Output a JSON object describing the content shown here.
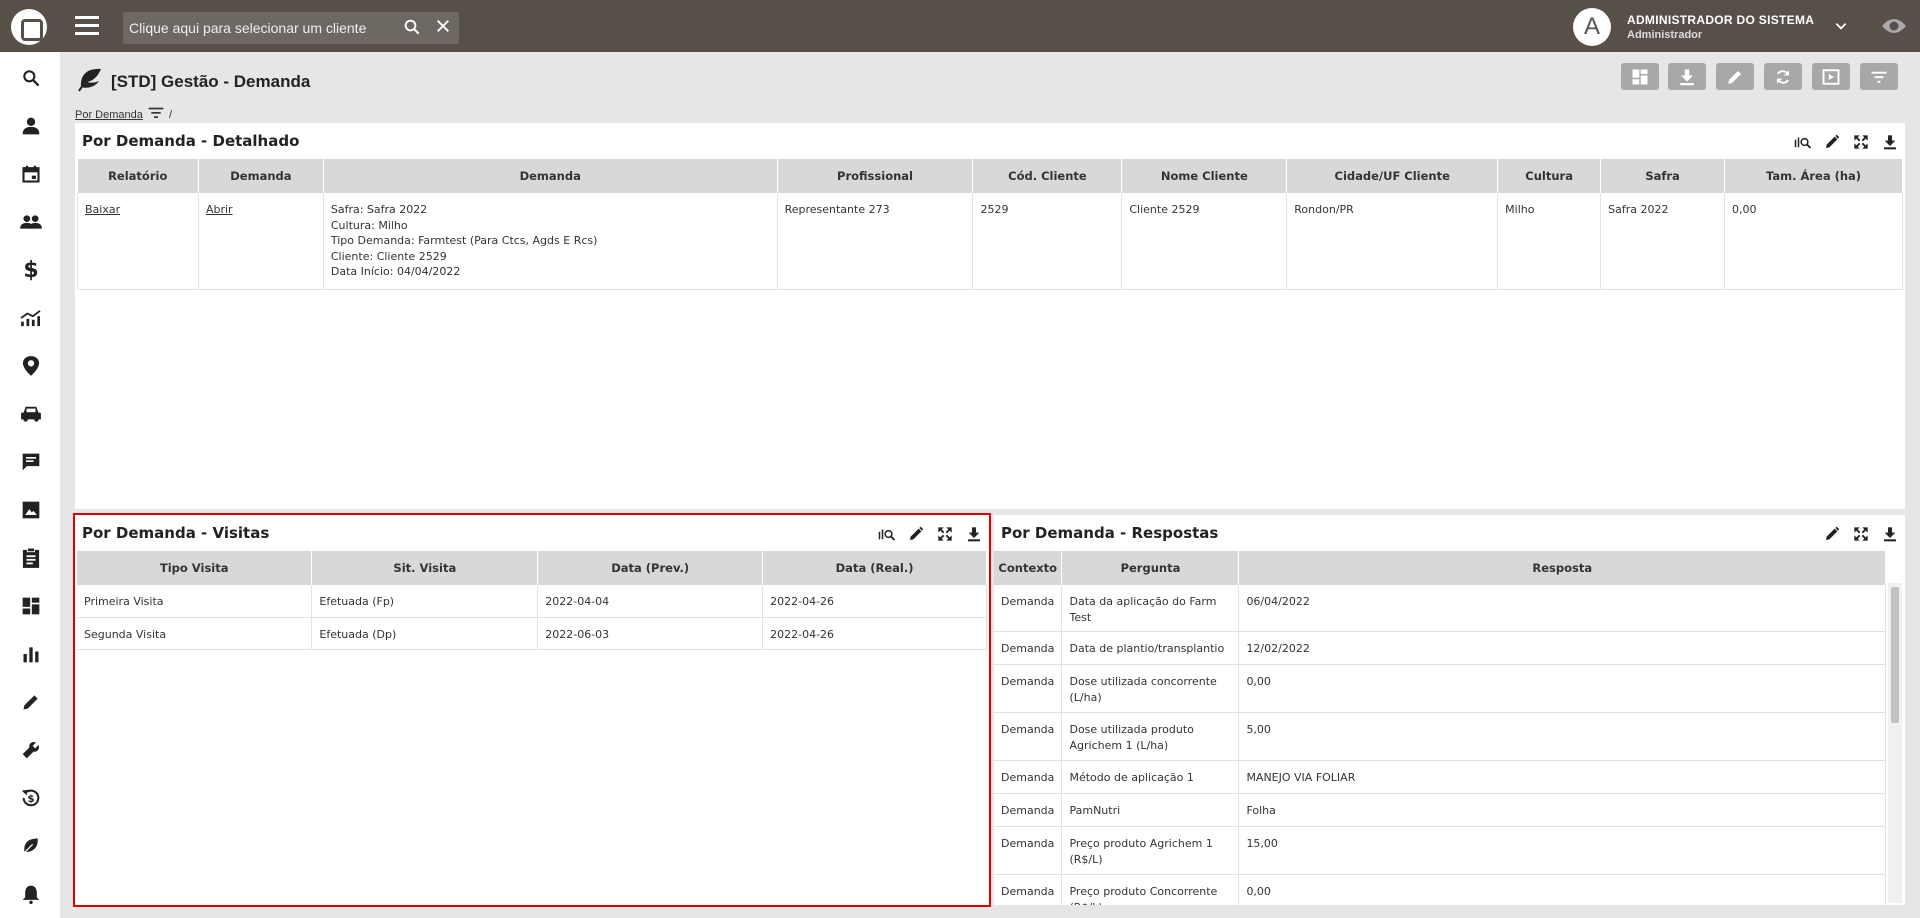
{
  "topbar": {
    "search_placeholder": "Clique aqui para selecionar um cliente",
    "avatar_letter": "A",
    "user_name": "ADMINISTRADOR DO SISTEMA",
    "user_role": "Administrador"
  },
  "sidebar": {
    "items": [
      "search",
      "person",
      "calendar",
      "people",
      "dollar",
      "chart-trend",
      "location-pin",
      "car",
      "chat",
      "image",
      "clipboard",
      "dashboard",
      "bar-chart",
      "pencil",
      "wrench",
      "money-history",
      "leaf",
      "alert"
    ]
  },
  "page": {
    "title": "[STD] Gestão - Demanda",
    "breadcrumb_link": "Por Demanda",
    "breadcrumb_sep": "/"
  },
  "panel_detail": {
    "title": "Por Demanda - Detalhado",
    "headers": [
      "Relatório",
      "Demanda",
      "Demanda",
      "Profissional",
      "Cód. Cliente",
      "Nome Cliente",
      "Cidade/UF Cliente",
      "Cultura",
      "Safra",
      "Tam. Área (ha)"
    ],
    "row": {
      "relatorio": "Baixar",
      "demanda_link": "Abrir",
      "demanda_lines": [
        "Safra: Safra 2022",
        "Cultura: Milho",
        "Tipo Demanda: Farmtest (Para Ctcs, Agds E Rcs)",
        "Cliente: Cliente 2529",
        "Data Início: 04/04/2022"
      ],
      "profissional": "Representante 273",
      "cod_cliente": "2529",
      "nome_cliente": "Cliente 2529",
      "cidade": "Rondon/PR",
      "cultura": "Milho",
      "safra": "Safra 2022",
      "area": "0,00"
    }
  },
  "panel_visits": {
    "title": "Por Demanda - Visitas",
    "headers": [
      "Tipo Visita",
      "Sit. Visita",
      "Data (Prev.)",
      "Data (Real.)"
    ],
    "rows": [
      [
        "Primeira Visita",
        "Efetuada (Fp)",
        "2022-04-04",
        "2022-04-26"
      ],
      [
        "Segunda Visita",
        "Efetuada (Dp)",
        "2022-06-03",
        "2022-04-26"
      ]
    ]
  },
  "panel_answers": {
    "title": "Por Demanda - Respostas",
    "headers": [
      "Contexto",
      "Pergunta",
      "Resposta"
    ],
    "rows": [
      [
        "Demanda",
        "Data da aplicação do Farm Test",
        "06/04/2022"
      ],
      [
        "Demanda",
        "Data de plantio/transplantio",
        "12/02/2022"
      ],
      [
        "Demanda",
        "Dose utilizada concorrente (L/ha)",
        "0,00"
      ],
      [
        "Demanda",
        "Dose utilizada produto Agrichem 1 (L/ha)",
        "5,00"
      ],
      [
        "Demanda",
        "Método de aplicação 1",
        "MANEJO VIA FOLIAR"
      ],
      [
        "Demanda",
        "PamNutri",
        "Folha"
      ],
      [
        "Demanda",
        "Preço produto Agrichem 1 (R$/L)",
        "15,00"
      ],
      [
        "Demanda",
        "Preço produto Concorrente (R$/L)",
        "0,00"
      ]
    ]
  },
  "colors": {
    "topbar": "#575049",
    "highlight": "#e00000",
    "header_bg": "#d8d8d8"
  }
}
